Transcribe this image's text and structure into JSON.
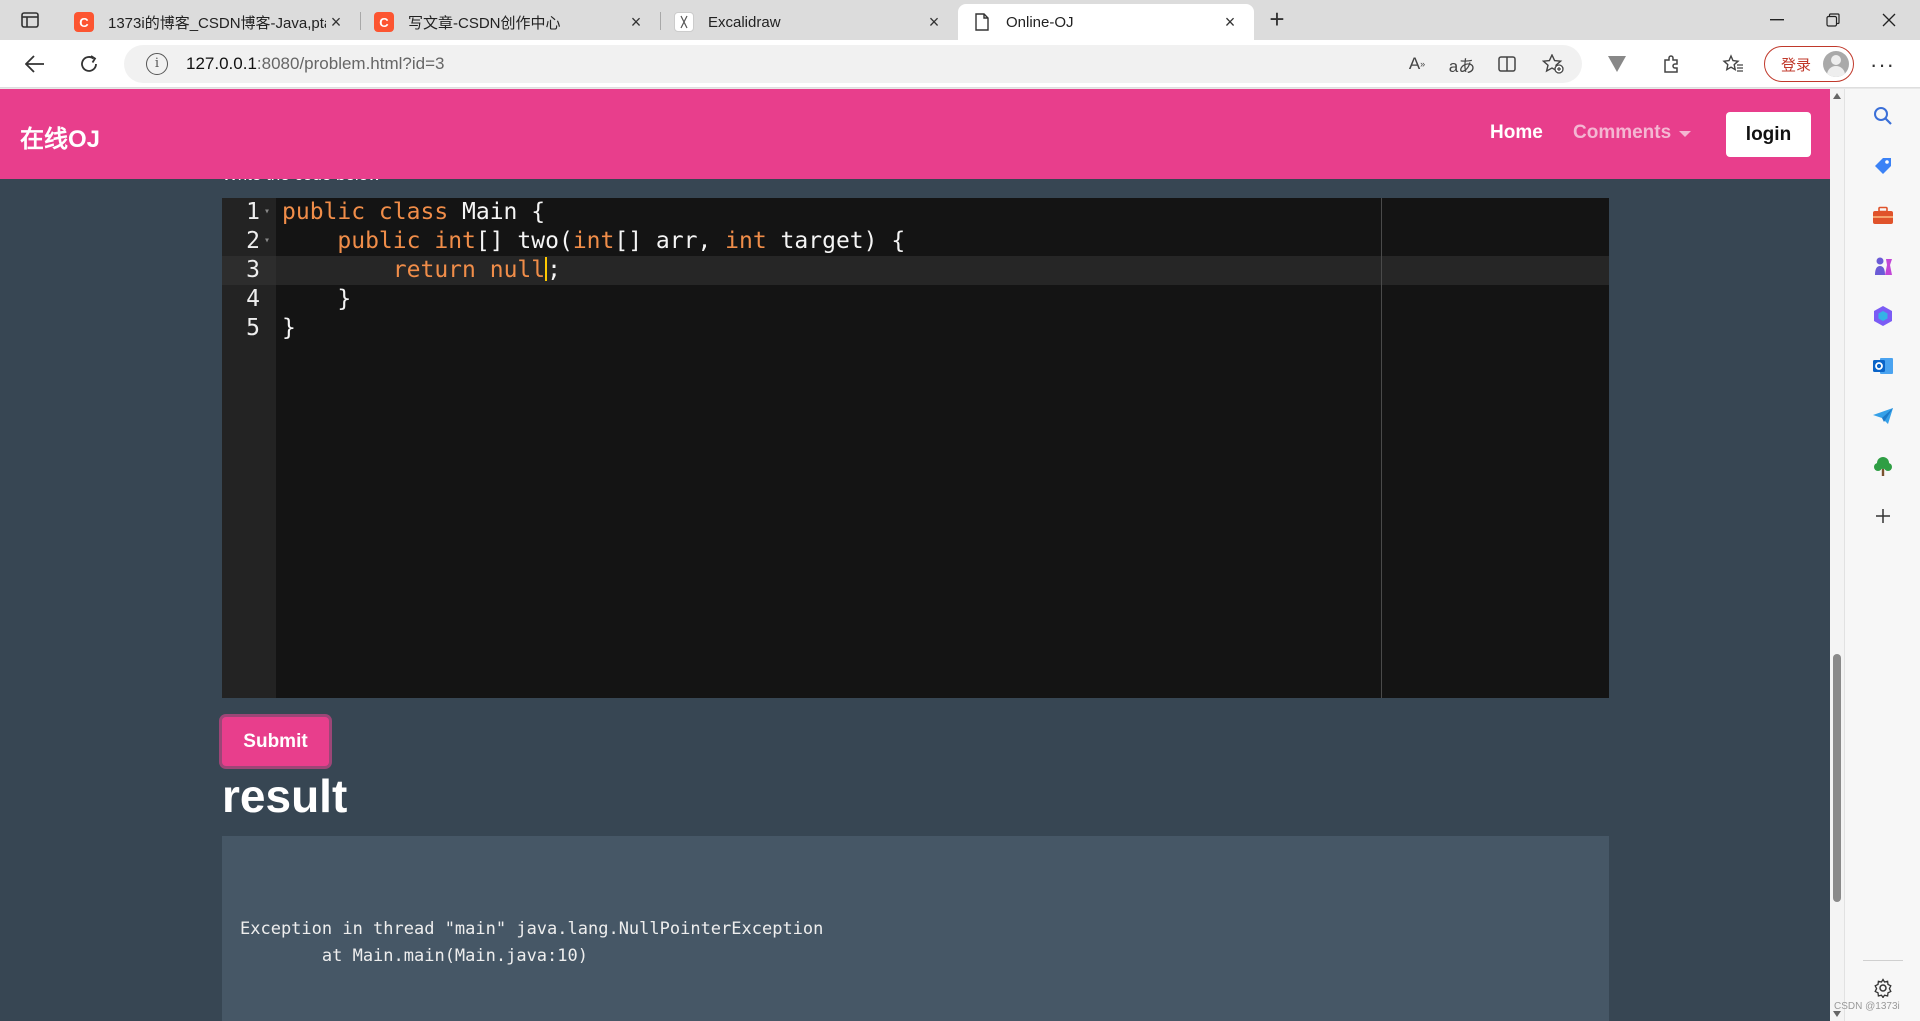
{
  "browser": {
    "tabs": [
      {
        "title": "1373i的博客_CSDN博客-Java,pta",
        "favicon_letter": "C",
        "favicon_color": "#fc5531",
        "active": false
      },
      {
        "title": "写文章-CSDN创作中心",
        "favicon_letter": "C",
        "favicon_color": "#fc5531",
        "active": false
      },
      {
        "title": "Excalidraw",
        "favicon_letter": "",
        "favicon_color": "#ffffff",
        "active": false
      },
      {
        "title": "Online-OJ",
        "favicon_letter": "",
        "favicon_color": "#ffffff",
        "active": true
      }
    ],
    "close_glyph": "×",
    "new_tab_glyph": "+",
    "address": {
      "host": "127.0.0.1",
      "rest": ":8080/problem.html?id=3"
    },
    "signin_label": "登录",
    "more_glyph": "···"
  },
  "site": {
    "brand": "在线OJ",
    "nav": {
      "home": "Home",
      "comments": "Comments",
      "login": "login"
    },
    "prompt": "Write the code below"
  },
  "editor": {
    "active_line": 3,
    "lines": [
      {
        "num": "1",
        "fold": "▾",
        "parts": [
          {
            "t": "public class",
            "k": true
          },
          {
            "t": " Main {",
            "k": false
          }
        ]
      },
      {
        "num": "2",
        "fold": "▾",
        "parts": [
          {
            "t": "    ",
            "k": false
          },
          {
            "t": "public",
            "k": true
          },
          {
            "t": " ",
            "k": false
          },
          {
            "t": "int",
            "k": true
          },
          {
            "t": "[] two(",
            "k": false
          },
          {
            "t": "int",
            "k": true
          },
          {
            "t": "[] arr, ",
            "k": false
          },
          {
            "t": "int",
            "k": true
          },
          {
            "t": " target) {",
            "k": false
          }
        ]
      },
      {
        "num": "3",
        "fold": "",
        "parts": [
          {
            "t": "        ",
            "k": false
          },
          {
            "t": "return",
            "k": true
          },
          {
            "t": " ",
            "k": false
          },
          {
            "t": "null",
            "k": true
          },
          {
            "t": "|",
            "k": false
          },
          {
            "t": ";",
            "k": false
          }
        ]
      },
      {
        "num": "4",
        "fold": "",
        "parts": [
          {
            "t": "    }",
            "k": false
          }
        ]
      },
      {
        "num": "5",
        "fold": "",
        "parts": [
          {
            "t": "}",
            "k": false
          }
        ]
      }
    ]
  },
  "submit_label": "Submit",
  "result": {
    "heading": "result",
    "output": "Exception in thread \"main\" java.lang.NullPointerException\n        at Main.main(Main.java:10)"
  },
  "watermark": "CSDN @1373i",
  "colors": {
    "brand_pink": "#e83e8c",
    "page_bg": "#374653",
    "editor_bg": "#141414",
    "keyword": "#f08d49",
    "result_bg": "#465766"
  }
}
